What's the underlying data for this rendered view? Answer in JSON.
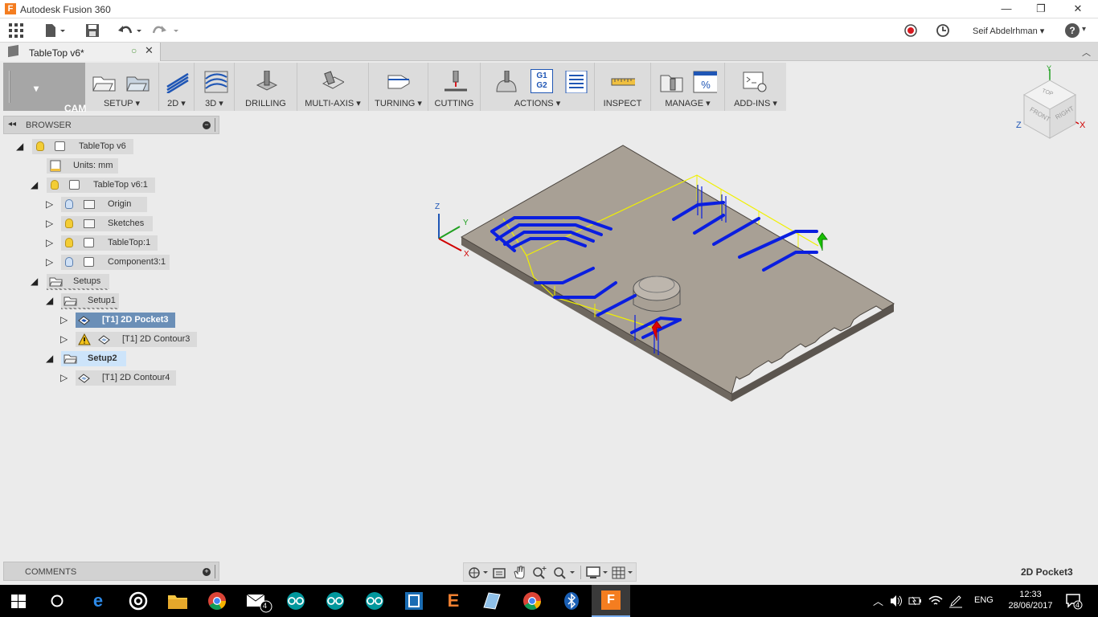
{
  "app": {
    "title": "Autodesk Fusion 360",
    "icon_letter": "F"
  },
  "window_controls": {
    "minimize": "—",
    "restore": "❐",
    "close": "✕"
  },
  "qat": {
    "user": "Seif Abdelrhman",
    "help": "?"
  },
  "doc_tab": {
    "name": "TableTop v6*"
  },
  "toolbar": {
    "workspace": "CAM",
    "groups": [
      "SETUP",
      "2D",
      "3D",
      "DRILLING",
      "MULTI-AXIS",
      "TURNING",
      "CUTTING",
      "ACTIONS",
      "INSPECT",
      "MANAGE",
      "ADD-INS"
    ],
    "actions_g1": "G1",
    "actions_g2": "G2"
  },
  "browser": {
    "title": "BROWSER",
    "items": [
      {
        "label": "TableTop v6"
      },
      {
        "label": "Units: mm"
      },
      {
        "label": "TableTop v6:1"
      },
      {
        "label": "Origin"
      },
      {
        "label": "Sketches"
      },
      {
        "label": "TableTop:1"
      },
      {
        "label": "Component3:1"
      },
      {
        "label": "Setups"
      },
      {
        "label": "Setup1"
      },
      {
        "label": "[T1] 2D Pocket3"
      },
      {
        "label": "[T1] 2D Contour3"
      },
      {
        "label": "Setup2"
      },
      {
        "label": "[T1] 2D Contour4"
      }
    ]
  },
  "viewcube": {
    "top": "TOP",
    "front": "FRONT",
    "right": "RIGHT",
    "x": "X",
    "y": "Y",
    "z": "Z"
  },
  "triad": {
    "x": "X",
    "y": "Y",
    "z": "Z"
  },
  "comments": {
    "label": "COMMENTS"
  },
  "status": {
    "selection": "2D Pocket3"
  },
  "taskbar": {
    "mail_badge": "4",
    "language": "ENG",
    "time": "12:33",
    "date": "28/06/2017",
    "notifications": "4"
  },
  "colors": {
    "toolpath": "#0a1ee0",
    "rapid": "#f0f000",
    "stock": "#a8a095",
    "selection": "#6b8fb7"
  }
}
